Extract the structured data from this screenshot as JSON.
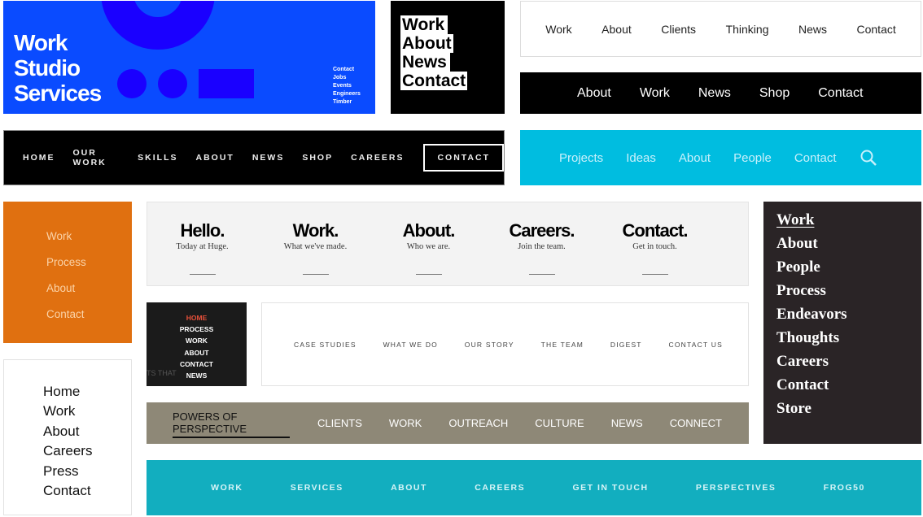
{
  "panel1": {
    "big": [
      "Work",
      "Studio",
      "Services"
    ],
    "small": [
      "Contact",
      "Jobs",
      "Events",
      "Engineers",
      "Timber"
    ]
  },
  "panel2": {
    "items": [
      "Work",
      "About",
      "News",
      "Contact"
    ]
  },
  "panel3": {
    "items": [
      "Work",
      "About",
      "Clients",
      "Thinking",
      "News",
      "Contact"
    ]
  },
  "panel4": {
    "items": [
      "About",
      "Work",
      "News",
      "Shop",
      "Contact"
    ]
  },
  "panel5": {
    "items": [
      "HOME",
      "OUR WORK",
      "SKILLS",
      "ABOUT",
      "NEWS",
      "SHOP",
      "CAREERS"
    ],
    "cta": "CONTACT"
  },
  "panel6": {
    "items": [
      "Projects",
      "Ideas",
      "About",
      "People",
      "Contact"
    ],
    "icon": "search-icon"
  },
  "panel7": {
    "items": [
      "Work",
      "Process",
      "About",
      "Contact"
    ]
  },
  "panel8": {
    "items": [
      {
        "t": "Hello.",
        "s": "Today at Huge."
      },
      {
        "t": "Work.",
        "s": "What we've made."
      },
      {
        "t": "About.",
        "s": "Who we are."
      },
      {
        "t": "Careers.",
        "s": "Join the team."
      },
      {
        "t": "Contact.",
        "s": "Get in touch."
      }
    ]
  },
  "panel9": {
    "items": [
      "Work",
      "About",
      "People",
      "Process",
      "Endeavors",
      "Thoughts",
      "Careers",
      "Contact",
      "Store"
    ]
  },
  "panel10": {
    "items": [
      "HOME",
      "PROCESS",
      "WORK",
      "ABOUT",
      "CONTACT",
      "NEWS"
    ],
    "bg_text": "TS THAT"
  },
  "panel11": {
    "items": [
      "CASE STUDIES",
      "WHAT WE DO",
      "OUR STORY",
      "THE TEAM",
      "DIGEST",
      "CONTACT US"
    ]
  },
  "panel12": {
    "items": [
      "Home",
      "Work",
      "About",
      "Careers",
      "Press",
      "Contact"
    ]
  },
  "panel13": {
    "items": [
      "POWERS OF PERSPECTIVE",
      "CLIENTS",
      "WORK",
      "OUTREACH",
      "CULTURE",
      "NEWS",
      "CONNECT"
    ]
  },
  "panel14": {
    "items": [
      "WORK",
      "SERVICES",
      "ABOUT",
      "CAREERS",
      "GET IN TOUCH",
      "PERSPECTIVES",
      "FROG50"
    ]
  },
  "colors": {
    "blue": "#0a4bff",
    "orange": "#e07010",
    "cyan": "#00bde0",
    "teal": "#12aebf",
    "khaki": "#8e8877",
    "dark": "#2a2426",
    "red": "#e8503a"
  }
}
